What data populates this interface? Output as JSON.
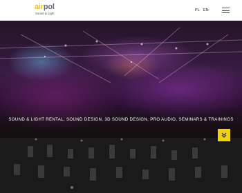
{
  "header": {
    "logo": {
      "line1_a": "air",
      "line1_b": "pol",
      "line2": "Sound & Light"
    },
    "languages": [
      "PL",
      "EN"
    ],
    "menu_icon": "hamburger-icon"
  },
  "hero": {
    "tagline": "SOUND & LIGHT RENTAL, SOUND DESIGN, 3D SOUND DESIGN, PRO AUDIO, SEMINARS & TRAININGS",
    "scroll_icon": "double-chevron-down-icon"
  },
  "colors": {
    "accent": "#f0d21a",
    "logo_yellow": "#e7c21a",
    "logo_gray": "#666a73"
  }
}
